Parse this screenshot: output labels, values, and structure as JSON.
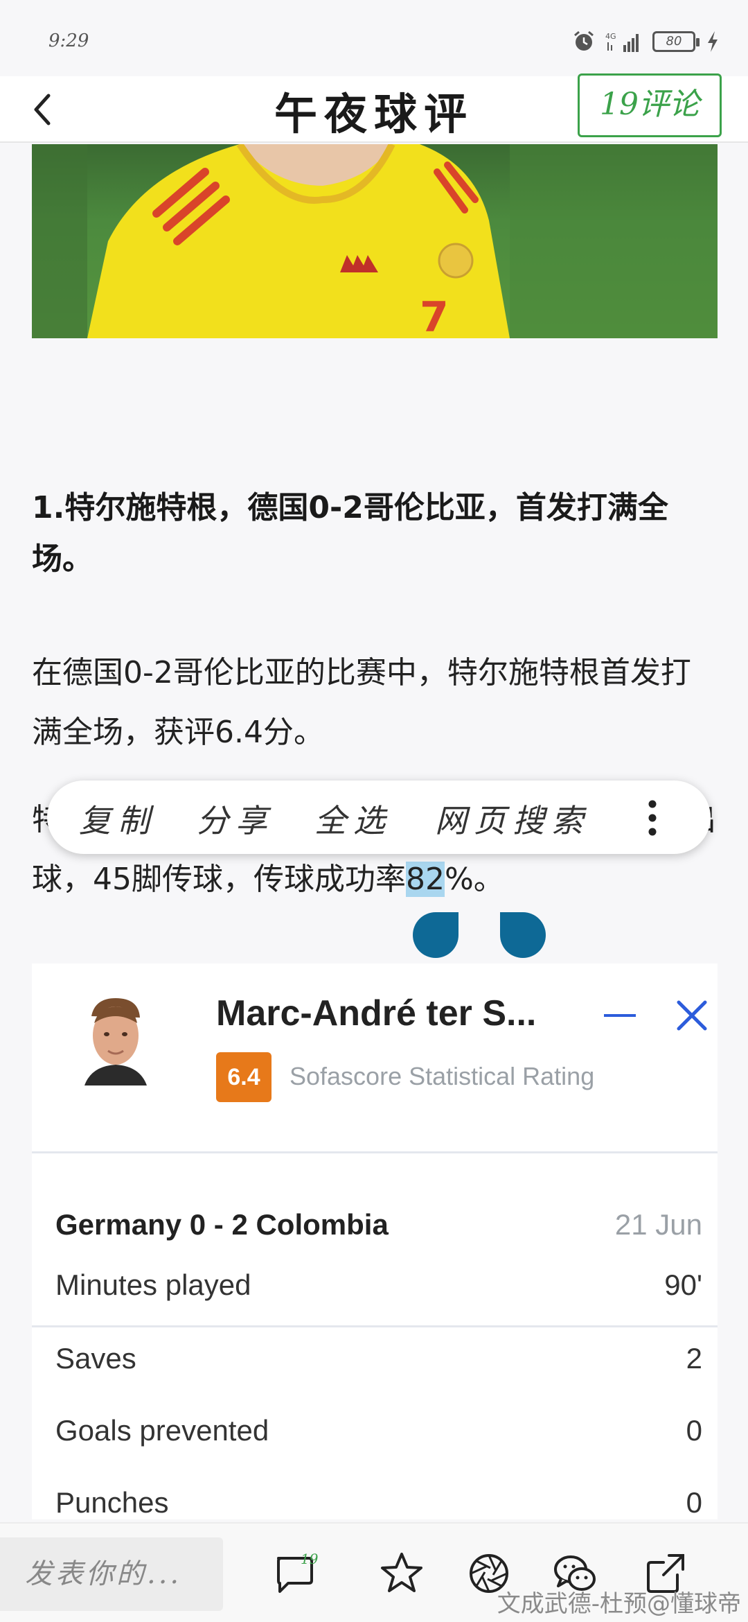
{
  "status_bar": {
    "time": "9:29",
    "battery": "80",
    "network": "4G"
  },
  "header": {
    "title": "午夜球评",
    "comments_button": "19评论"
  },
  "article": {
    "heading": "1.特尔施特根，德国0-2哥伦比亚，首发打满全场。",
    "para1": "在德国0-2哥伦比亚的比赛中，特尔施特根首发打满全场，获评6.4分。",
    "para2_hidden_start": "特",
    "para2_hidden_end": "出",
    "para2_line2_before": "球，45脚传球，传球成功率",
    "para2_selected": "82",
    "para2_after": "%。"
  },
  "context_menu": {
    "copy": "复制",
    "share": "分享",
    "select_all": "全选",
    "web_search": "网页搜索"
  },
  "score_card": {
    "player_name": "Marc-André ter S...",
    "rating": "6.4",
    "rating_label": "Sofascore Statistical Rating",
    "match": "Germany 0 - 2 Colombia",
    "date": "21 Jun",
    "stats": [
      {
        "label": "Minutes played",
        "value": "90'"
      },
      {
        "label": "Saves",
        "value": "2"
      },
      {
        "label": "Goals prevented",
        "value": "0"
      },
      {
        "label": "Punches",
        "value": "0"
      }
    ]
  },
  "bottom_bar": {
    "comment_placeholder": "发表你的...",
    "comment_count": "19",
    "watermark": "文成武德-杜预@懂球帝"
  },
  "colors": {
    "accent_green": "#3ba24a",
    "rating_orange": "#e7791a",
    "sofascore_blue": "#2c5cdb",
    "selection_blue": "#0e6996"
  }
}
